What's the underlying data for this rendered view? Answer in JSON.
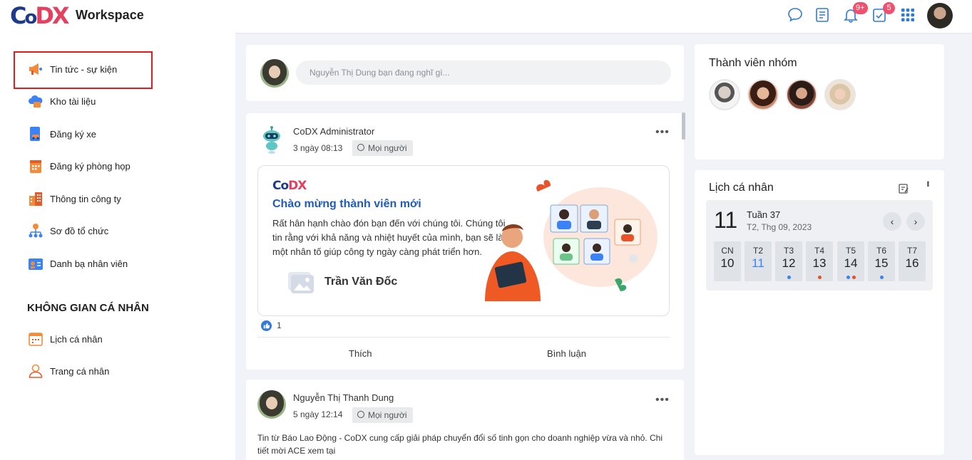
{
  "header": {
    "logo": {
      "c": "C",
      "o": "o",
      "d": "D",
      "x": "X"
    },
    "brand": "Workspace",
    "notification_badge": "9+",
    "task_badge": "5"
  },
  "sidebar": {
    "items": [
      {
        "label": "Tin tức - sự kiện",
        "icon": "megaphone-icon"
      },
      {
        "label": "Kho tài liệu",
        "icon": "cloud-folder-icon"
      },
      {
        "label": "Đăng ký xe",
        "icon": "car-document-icon"
      },
      {
        "label": "Đăng ký phòng họp",
        "icon": "calendar-building-icon"
      },
      {
        "label": "Thông tin công ty",
        "icon": "buildings-icon"
      },
      {
        "label": "Sơ đồ tổ chức",
        "icon": "org-chart-icon"
      },
      {
        "label": "Danh bạ nhân viên",
        "icon": "contact-card-icon"
      }
    ],
    "personal_section_title": "KHÔNG GIAN CÁ NHÂN",
    "personal_items": [
      {
        "label": "Lịch cá nhân",
        "icon": "calendar-icon"
      },
      {
        "label": "Trang cá nhân",
        "icon": "person-icon"
      }
    ]
  },
  "composer": {
    "placeholder": "Nguyễn Thị Dung bạn đang nghĩ gì..."
  },
  "posts": [
    {
      "author": "CoDX Administrator",
      "time": "3 ngày 08:13",
      "audience": "Mọi người",
      "banner": {
        "logo_c": "Co",
        "logo_dx": "DX",
        "title": "Chào mừng thành viên mới",
        "text": "Rất hân hạnh chào đón bạn đến với chúng tôi. Chúng tôi tin rằng với khả năng và nhiệt huyết của mình, bạn sẽ là một nhân tố giúp công ty ngày càng phát triển hơn.",
        "name": "Trần Văn Đốc"
      },
      "likes": "1",
      "actions": {
        "like": "Thích",
        "comment": "Bình luận"
      }
    },
    {
      "author": "Nguyễn Thị Thanh Dung",
      "time": "5 ngày 12:14",
      "audience": "Mọi người",
      "text": "Tin từ Báo Lao Động - CoDX cung cấp giải pháp chuyển đổi số tinh gọn cho doanh nghiệp vừa và nhỏ. Chi tiết mời ACE xem tại"
    }
  ],
  "members": {
    "title": "Thành viên nhóm"
  },
  "calendar": {
    "title": "Lịch cá nhân",
    "big_day": "11",
    "week": "Tuần 37",
    "date": "T2, Thg 09, 2023",
    "days": [
      {
        "name": "CN",
        "num": "10",
        "dots": []
      },
      {
        "name": "T2",
        "num": "11",
        "dots": [],
        "today": true
      },
      {
        "name": "T3",
        "num": "12",
        "dots": [
          "#3b82f6"
        ]
      },
      {
        "name": "T4",
        "num": "13",
        "dots": [
          "#e5502a"
        ]
      },
      {
        "name": "T5",
        "num": "14",
        "dots": [
          "#3b82f6",
          "#e5502a"
        ]
      },
      {
        "name": "T6",
        "num": "15",
        "dots": [
          "#3b82f6"
        ]
      },
      {
        "name": "T7",
        "num": "16",
        "dots": []
      }
    ]
  },
  "colors": {
    "accent": "#1f5bbf",
    "badge": "#f0506e",
    "highlight_border": "#e11c1c",
    "today": "#3b82f6"
  }
}
